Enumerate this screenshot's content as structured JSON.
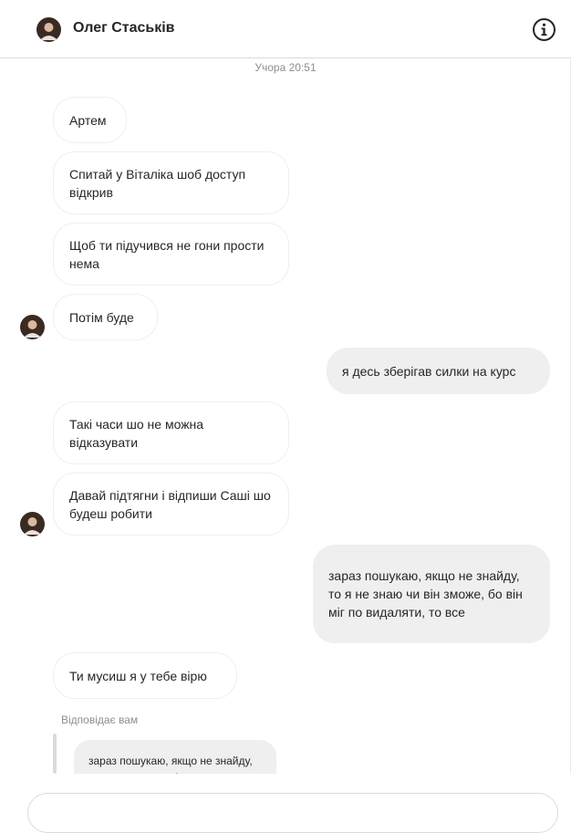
{
  "header": {
    "contact_name": "Олег Стаськів",
    "info_icon": "info-icon"
  },
  "timestamp": "Учора 20:51",
  "messages": [
    {
      "direction": "incoming",
      "text": "Артем"
    },
    {
      "direction": "incoming",
      "text": "Спитай у Віталіка шоб доступ відкрив"
    },
    {
      "direction": "incoming",
      "text": "Щоб ти підучився не гони прости нема"
    },
    {
      "direction": "incoming",
      "text": "Потім буде"
    },
    {
      "direction": "outgoing",
      "text": "я десь зберігав силки на курс"
    },
    {
      "direction": "incoming",
      "text": "Такі часи шо не можна відказувати"
    },
    {
      "direction": "incoming",
      "text": "Давай підтягни і відпиши Саші шо будеш робити"
    },
    {
      "direction": "outgoing",
      "text": "зараз пошукаю, якщо не знайду, то я не знаю чи він зможе, бо він міг по видаляти, то все"
    },
    {
      "direction": "incoming",
      "text": "Ти мусиш я у тебе вірю"
    }
  ],
  "reply": {
    "label": "Відповідає вам",
    "quoted_text": "зараз пошукаю, якщо не знайду, то я не знаю чи він"
  },
  "colors": {
    "outgoing_bubble": "#efefef",
    "incoming_border": "#efefef",
    "secondary_text": "#8e8e8e"
  }
}
